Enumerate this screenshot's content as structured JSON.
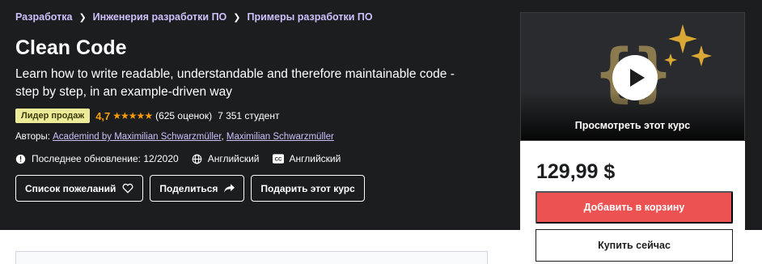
{
  "breadcrumb": [
    "Разработка",
    "Инженерия разработки ПО",
    "Примеры разработки ПО"
  ],
  "course": {
    "title": "Clean Code",
    "subtitle": "Learn how to write readable, understandable and therefore maintainable code - step by step, in an example-driven way",
    "badge": "Лидер продаж",
    "rating": "4,7",
    "rating_value": 4.7,
    "ratings_count": "(625 оценок)",
    "students": "7 351 студент",
    "authors_label": "Авторы:",
    "authors": [
      "Academind by Maximilian Schwarzmüller",
      "Maximilian Schwarzmüller"
    ],
    "last_updated": "Последнее обновление: 12/2020",
    "language": "Английский",
    "captions": "Английский"
  },
  "actions": {
    "wishlist": "Список пожеланий",
    "share": "Поделиться",
    "gift": "Подарить этот курс"
  },
  "sidebar": {
    "preview_label": "Просмотреть этот курс",
    "price": "129,99 $",
    "add_to_cart": "Добавить в корзину",
    "buy_now": "Купить сейчас"
  },
  "colors": {
    "hero_bg": "#1c1d1f",
    "accent_link": "#cec0fc",
    "rating": "#f69c08",
    "badge": "#eceb98",
    "cart_button": "#ec5252"
  }
}
